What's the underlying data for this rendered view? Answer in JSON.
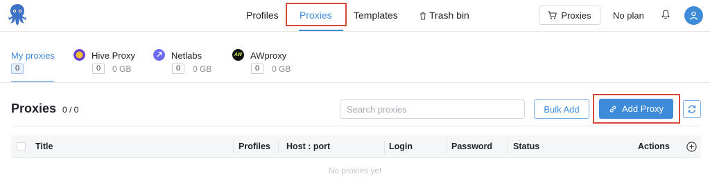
{
  "header": {
    "nav": [
      {
        "label": "Profiles"
      },
      {
        "label": "Proxies"
      },
      {
        "label": "Templates"
      },
      {
        "label": "Trash bin"
      }
    ],
    "proxies_button_label": "Proxies",
    "plan_label": "No plan"
  },
  "provider_tabs": [
    {
      "label": "My proxies",
      "count": "0"
    },
    {
      "label": "Hive Proxy",
      "count": "0",
      "gb": "0 GB",
      "icon": "hive-proxy-icon",
      "color": "#f2c230"
    },
    {
      "label": "Netlabs",
      "count": "0",
      "gb": "0 GB",
      "icon": "netlabs-icon",
      "color": "#6b6cf0"
    },
    {
      "label": "AWproxy",
      "count": "0",
      "gb": "0 GB",
      "icon": "awproxy-icon",
      "color": "#111111",
      "icon_text": "AW"
    }
  ],
  "toolbar": {
    "title": "Proxies",
    "count": "0 / 0",
    "search_placeholder": "Search proxies",
    "bulk_add_label": "Bulk Add",
    "add_proxy_label": "Add Proxy"
  },
  "table": {
    "columns": [
      "Title",
      "Profiles",
      "Host : port",
      "Login",
      "Password",
      "Status",
      "Actions"
    ],
    "empty_text": "No proxies yet"
  },
  "colors": {
    "accent": "#3d8bd9",
    "highlight_box": "#d9463a"
  }
}
